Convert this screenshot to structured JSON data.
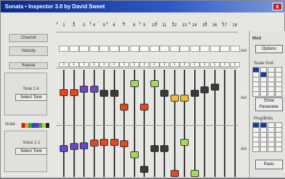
{
  "window": {
    "title": "Sonata • Inspector 3.0 by David Sweet",
    "close_glyph": "x"
  },
  "left_panel": {
    "channel_label": "Channel",
    "value_label": "Velocity",
    "repeat_label": "Repeat",
    "group1": {
      "label": "Tone   1  4",
      "button": "Select Tone"
    },
    "group2": {
      "label": "Voice   1  1",
      "button": "Select Tone"
    },
    "palette_label": "Scale"
  },
  "ruler_text": "1 ' 1 ' 1 ' 1 ' 1 ' 1 ' 1 ' 1 ' 1 ' 1 ' 1 ' 1",
  "steps": [
    "1",
    "2",
    "3",
    "4",
    "5",
    "6",
    "7",
    "8",
    "9",
    "10",
    "11",
    "12",
    "13",
    "14",
    "15",
    "16",
    "17",
    "18"
  ],
  "row_values": {
    "top": [
      "1",
      "1",
      "1",
      "1",
      "1",
      "1",
      "1",
      "1",
      "1",
      "1",
      "1",
      "1",
      "1",
      "1",
      "1",
      "1",
      "1",
      "1"
    ]
  },
  "mid_labels": {
    "a": "Act",
    "b": "Act",
    "c": "Act"
  },
  "right_panel": {
    "title": "Mod",
    "button1": "Options",
    "section1_label": "Scale Grid",
    "button2_line1": "Show",
    "button2_line2": "Parameter",
    "section2_label": "Prog/Bnks",
    "button3": "Panic",
    "grid1": [
      1,
      0,
      0,
      0,
      0,
      1,
      0,
      0,
      0,
      0,
      0,
      0,
      0,
      0,
      0,
      0,
      0,
      0,
      0,
      0,
      0,
      0,
      0,
      0
    ],
    "grid2": [
      1,
      1,
      0,
      0,
      0,
      0,
      0,
      0,
      0,
      0,
      0,
      0,
      0,
      0,
      0,
      0,
      0,
      0,
      0,
      0,
      0,
      0,
      0,
      0
    ]
  },
  "top_knobs": [
    {
      "step": 1,
      "level": 0.6,
      "color": "#e8461e"
    },
    {
      "step": 2,
      "level": 0.6,
      "color": "#e8461e"
    },
    {
      "step": 3,
      "level": 0.67,
      "color": "#6b47c8"
    },
    {
      "step": 4,
      "level": 0.67,
      "color": "#6b47c8"
    },
    {
      "step": 5,
      "level": 0.58,
      "color": "#3a3a3a"
    },
    {
      "step": 6,
      "level": 0.58,
      "color": "#3a3a3a"
    },
    {
      "step": 7,
      "level": 0.3,
      "color": "#e8461e"
    },
    {
      "step": 8,
      "level": 0.78,
      "color": "#a8d858"
    },
    {
      "step": 9,
      "level": 0.3,
      "color": "#e8461e"
    },
    {
      "step": 10,
      "level": 0.78,
      "color": "#a8d858"
    },
    {
      "step": 11,
      "level": 0.58,
      "color": "#3a3a3a"
    },
    {
      "step": 12,
      "level": 0.48,
      "color": "#f0c030"
    },
    {
      "step": 13,
      "level": 0.48,
      "color": "#f0c030"
    },
    {
      "step": 14,
      "level": 0.58,
      "color": "#3a3a3a"
    },
    {
      "step": 15,
      "level": 0.66,
      "color": "#3a3a3a"
    },
    {
      "step": 16,
      "level": 0.72,
      "color": "#3a3a3a"
    }
  ],
  "bottom_knobs": [
    {
      "step": 1,
      "level": 0.55,
      "color": "#6b47c8"
    },
    {
      "step": 2,
      "level": 0.6,
      "color": "#6b47c8"
    },
    {
      "step": 3,
      "level": 0.62,
      "color": "#6b47c8"
    },
    {
      "step": 4,
      "level": 0.68,
      "color": "#e8461e"
    },
    {
      "step": 5,
      "level": 0.7,
      "color": "#e8461e"
    },
    {
      "step": 6,
      "level": 0.7,
      "color": "#e8461e"
    },
    {
      "step": 7,
      "level": 0.66,
      "color": "#e8461e"
    },
    {
      "step": 8,
      "level": 0.42,
      "color": "#a8d858"
    },
    {
      "step": 9,
      "level": 0.1,
      "color": "#3a3a3a"
    },
    {
      "step": 10,
      "level": 0.56,
      "color": "#3a3a3a"
    },
    {
      "step": 11,
      "level": 0.56,
      "color": "#3a3a3a"
    },
    {
      "step": 12,
      "level": 0.0,
      "color": "#e8461e"
    },
    {
      "step": 13,
      "level": 0.7,
      "color": "#a8d858"
    },
    {
      "step": 14,
      "level": 0.0,
      "color": "#a8d858"
    }
  ],
  "palette": [
    "#d02020",
    "#e8a020",
    "#30a030",
    "#2050c0",
    "#8030a0",
    "#20a0a0",
    "#d0d020",
    "#202020"
  ]
}
